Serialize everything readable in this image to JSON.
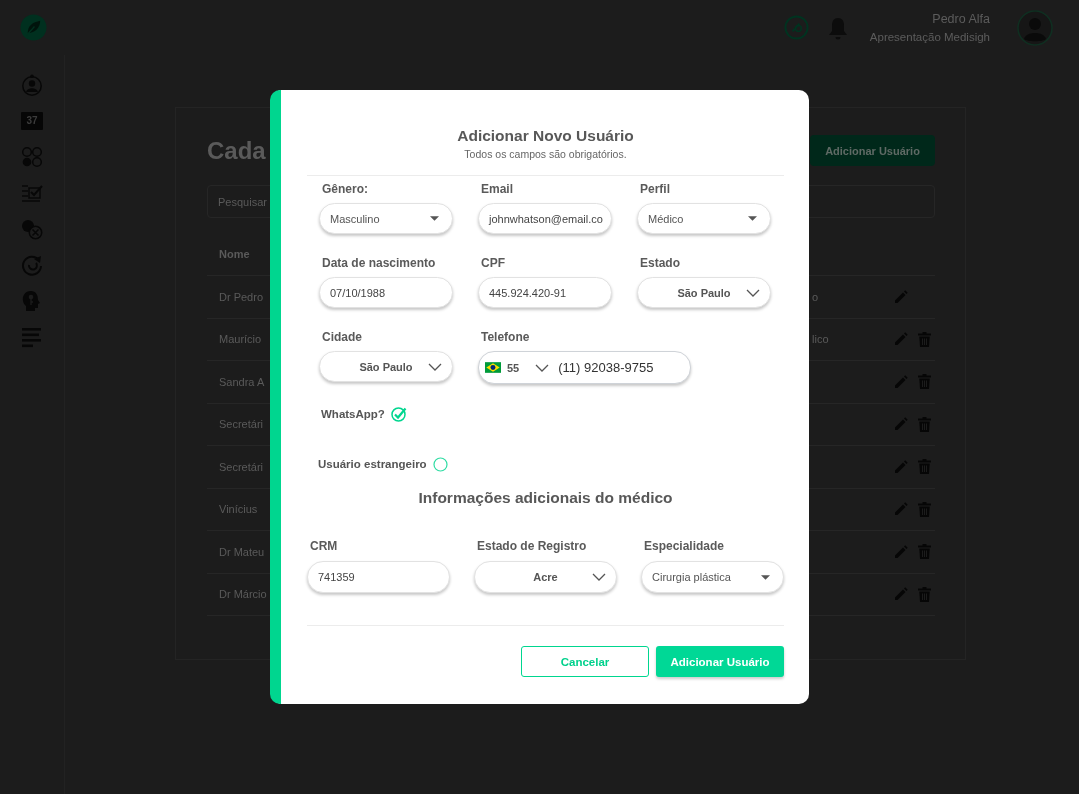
{
  "header": {
    "user_name": "Pedro Alfa",
    "user_role": "Apresentação Medisigh"
  },
  "sidebar": {
    "items": [
      {
        "kind": "profile"
      },
      {
        "kind": "calendar",
        "day": "37"
      },
      {
        "kind": "counters"
      },
      {
        "kind": "checklist"
      },
      {
        "kind": "check-cancel"
      },
      {
        "kind": "refresh"
      },
      {
        "kind": "head-key"
      },
      {
        "kind": "list"
      }
    ]
  },
  "page": {
    "title": "Cada",
    "add_button": "Adicionar Usuário",
    "search": {
      "placeholder": "Pesquisar"
    },
    "table": {
      "columns": [
        "Nome"
      ],
      "rows": [
        {
          "name": "Dr Pedro",
          "column_2": "o",
          "deletable": false
        },
        {
          "name": "Maurício",
          "column_2": "lico",
          "deletable": true
        },
        {
          "name": "Sandra A",
          "deletable": true
        },
        {
          "name": "Secretári",
          "deletable": true
        },
        {
          "name": "Secretári",
          "deletable": true
        },
        {
          "name": "Vinícius",
          "deletable": true
        },
        {
          "name": "Dr Mateu",
          "deletable": true
        },
        {
          "name": "Dr Márcio",
          "deletable": true
        }
      ]
    }
  },
  "modal": {
    "title": "Adicionar Novo Usuário",
    "subtitle": "Todos os campos são obrigatórios.",
    "fields": [
      {
        "label": "Gênero:",
        "kind": "select",
        "value": "Masculino"
      },
      {
        "label": "Email",
        "kind": "text",
        "value": "johnwhatson@email.co"
      },
      {
        "label": "Perfil",
        "kind": "select",
        "value": "Médico"
      },
      {
        "label": "Data de nascimento",
        "kind": "text",
        "value": "07/10/1988"
      },
      {
        "label": "CPF",
        "kind": "text",
        "value": "445.924.420-91"
      },
      {
        "label": "Estado",
        "kind": "combo",
        "value": "São Paulo"
      },
      {
        "label": "Cidade",
        "kind": "combo",
        "value": "São Paulo"
      },
      {
        "label": "Telefone",
        "kind": "phone",
        "country_code": "55",
        "value": "(11) 92038-9755"
      }
    ],
    "options": [
      {
        "label": "WhatsApp?",
        "checked": true
      },
      {
        "label": "Usuário estrangeiro",
        "checked": false
      }
    ],
    "section_title": "Informações adicionais do médico",
    "doctor_fields": [
      {
        "label": "CRM",
        "kind": "text",
        "value": "741359"
      },
      {
        "label": "Estado de Registro",
        "kind": "combo",
        "value": "Acre"
      },
      {
        "label": "Especialidade",
        "kind": "select",
        "value": "Cirurgia plástica"
      }
    ],
    "buttons": [
      {
        "label": "Cancelar",
        "kind": "secondary"
      },
      {
        "label": "Adicionar Usuário",
        "kind": "primary"
      }
    ]
  }
}
